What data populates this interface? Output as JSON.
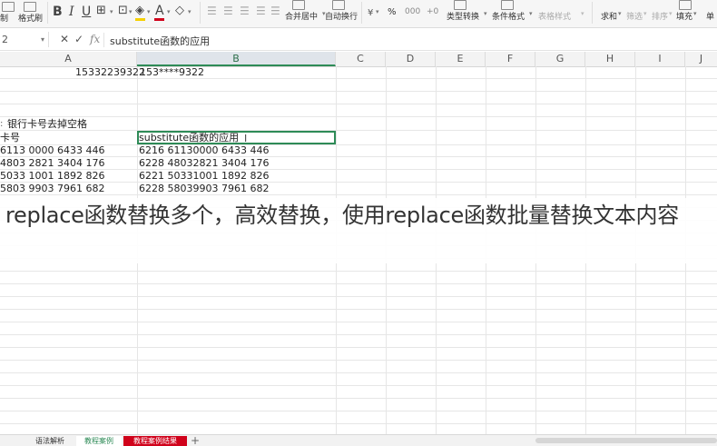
{
  "ribbon": {
    "paste_label": "制",
    "format_painter_label": "格式刷",
    "bold_label": "B",
    "italic_label": "I",
    "underline_label": "U",
    "font_color_label": "A",
    "merge_label": "合并居中",
    "wrap_label": "自动换行",
    "percent_label": "%",
    "type_convert_label": "类型转换",
    "cond_format_label": "条件格式",
    "table_style_label": "表格样式",
    "sum_label": "求和",
    "filter_label": "筛选",
    "sort_label": "排序",
    "fill_label": "填充",
    "single_label": "单",
    "font_color_hex": "#d0021b",
    "fill_color_hex": "#f5d000"
  },
  "formula_bar": {
    "name_box": "2",
    "formula": "substitute函数的应用"
  },
  "columns": [
    "A",
    "B",
    "C",
    "D",
    "E",
    "F",
    "G",
    "H",
    "I",
    "J"
  ],
  "selected_column": "B",
  "cells": {
    "r1a": "15332239322",
    "r1b": "153****9322",
    "r5a": "银行卡号去掉空格",
    "r6a": "卡号",
    "r6b": "substitute函数的应用",
    "r7a": "6113 0000 6433 446",
    "r7b": "6216 61130000 6433 446",
    "r8a": "4803 2821 3404 176",
    "r8b": "6228 48032821 3404 176",
    "r9a": "5033 1001 1892 826",
    "r9b": "6221 50331001 1892 826",
    "r10a": "5803 9903 7961 682",
    "r10b": "6228 58039903 7961 682"
  },
  "caption": "replace函数替换多个，高效替换，使用replace函数批量替换文本内容",
  "tabs": [
    {
      "label": "语法解析",
      "state": "normal"
    },
    {
      "label": "教程案例",
      "state": "active"
    },
    {
      "label": "教程案例结果",
      "state": "red"
    }
  ],
  "add_tab_label": "+"
}
